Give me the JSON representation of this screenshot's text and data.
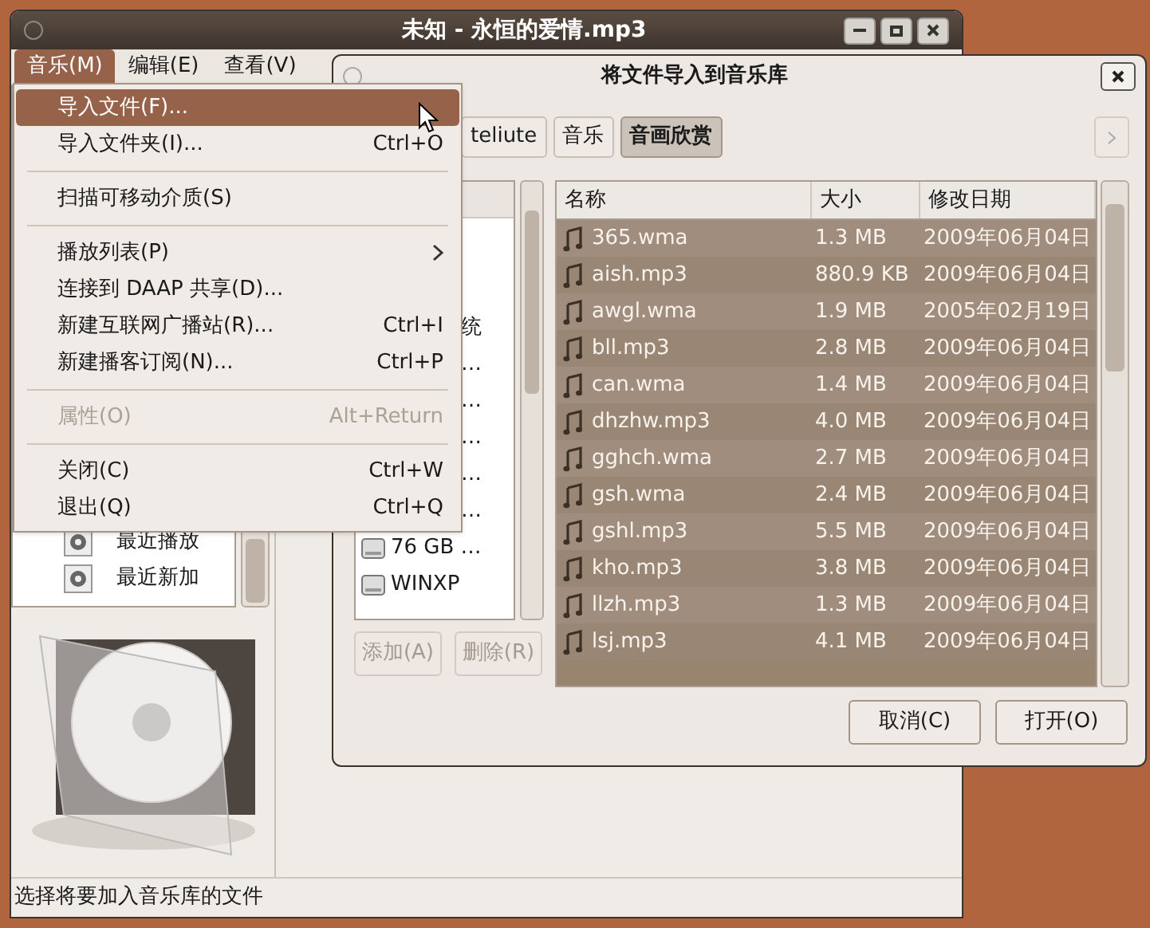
{
  "main_window": {
    "title": "未知 - 永恒的爱情.mp3",
    "menubar": [
      {
        "label": "音乐(M)",
        "selected": true
      },
      {
        "label": "编辑(E)",
        "selected": false
      },
      {
        "label": "查看(V)",
        "selected": false
      }
    ],
    "sidebar": {
      "items": [
        "最近播放",
        "最近新加"
      ]
    },
    "status_bar": "选择将要加入音乐库的文件"
  },
  "music_menu": {
    "items": [
      {
        "kind": "item",
        "label": "导入文件(F)...",
        "selected": true,
        "disabled": false
      },
      {
        "kind": "item",
        "label": "导入文件夹(I)...",
        "shortcut": "Ctrl+O",
        "selected": false,
        "disabled": false
      },
      {
        "kind": "separator"
      },
      {
        "kind": "item",
        "label": "扫描可移动介质(S)",
        "selected": false,
        "disabled": false
      },
      {
        "kind": "separator"
      },
      {
        "kind": "submenu",
        "label": "播放列表(P)",
        "selected": false,
        "disabled": false
      },
      {
        "kind": "item",
        "label": "连接到 DAAP 共享(D)...",
        "selected": false,
        "disabled": false
      },
      {
        "kind": "item",
        "label": "新建互联网广播站(R)...",
        "shortcut": "Ctrl+I",
        "selected": false,
        "disabled": false
      },
      {
        "kind": "item",
        "label": "新建播客订阅(N)...",
        "shortcut": "Ctrl+P",
        "selected": false,
        "disabled": false
      },
      {
        "kind": "separator"
      },
      {
        "kind": "item",
        "label": "属性(O)",
        "shortcut": "Alt+Return",
        "selected": false,
        "disabled": true
      },
      {
        "kind": "separator"
      },
      {
        "kind": "item",
        "label": "关闭(C)",
        "shortcut": "Ctrl+W",
        "selected": false,
        "disabled": false
      },
      {
        "kind": "item",
        "label": "退出(Q)",
        "shortcut": "Ctrl+Q",
        "selected": false,
        "disabled": false
      }
    ]
  },
  "import_dialog": {
    "title": "将文件导入到音乐库",
    "path_buttons": [
      {
        "label": "teliute",
        "selected": false
      },
      {
        "label": "音乐",
        "selected": false
      },
      {
        "label": "音画欣赏",
        "selected": true
      }
    ],
    "places": [
      {
        "kind": "fragment",
        "label": "统"
      },
      {
        "kind": "fragment",
        "label": "…"
      },
      {
        "kind": "fragment",
        "label": "…"
      },
      {
        "kind": "fragment",
        "label": "…"
      },
      {
        "kind": "fragment",
        "label": "…"
      },
      {
        "kind": "fragment",
        "label": "…"
      },
      {
        "kind": "drive",
        "label": "76 GB …"
      },
      {
        "kind": "drive",
        "label": "WINXP"
      }
    ],
    "place_buttons": [
      {
        "label": "添加(A)",
        "disabled": true
      },
      {
        "label": "删除(R)",
        "disabled": true
      }
    ],
    "file_list": {
      "columns": [
        "名称",
        "大小",
        "修改日期"
      ],
      "rows": [
        {
          "name": "365.wma",
          "size": "1.3 MB",
          "date": "2009年06月04日",
          "selected": true
        },
        {
          "name": "aish.mp3",
          "size": "880.9 KB",
          "date": "2009年06月04日",
          "selected": true
        },
        {
          "name": "awgl.wma",
          "size": "1.9 MB",
          "date": "2005年02月19日",
          "selected": true
        },
        {
          "name": "bll.mp3",
          "size": "2.8 MB",
          "date": "2009年06月04日",
          "selected": true
        },
        {
          "name": "can.wma",
          "size": "1.4 MB",
          "date": "2009年06月04日",
          "selected": true
        },
        {
          "name": "dhzhw.mp3",
          "size": "4.0 MB",
          "date": "2009年06月04日",
          "selected": true
        },
        {
          "name": "gghch.wma",
          "size": "2.7 MB",
          "date": "2009年06月04日",
          "selected": true
        },
        {
          "name": "gsh.wma",
          "size": "2.4 MB",
          "date": "2009年06月04日",
          "selected": true
        },
        {
          "name": "gshl.mp3",
          "size": "5.5 MB",
          "date": "2009年06月04日",
          "selected": true
        },
        {
          "name": "kho.mp3",
          "size": "3.8 MB",
          "date": "2009年06月04日",
          "selected": true
        },
        {
          "name": "llzh.mp3",
          "size": "1.3 MB",
          "date": "2009年06月04日",
          "selected": true
        },
        {
          "name": "lsj.mp3",
          "size": "4.1 MB",
          "date": "2009年06月04日",
          "selected": true
        }
      ]
    },
    "buttons": [
      "取消(C)",
      "打开(O)"
    ]
  }
}
